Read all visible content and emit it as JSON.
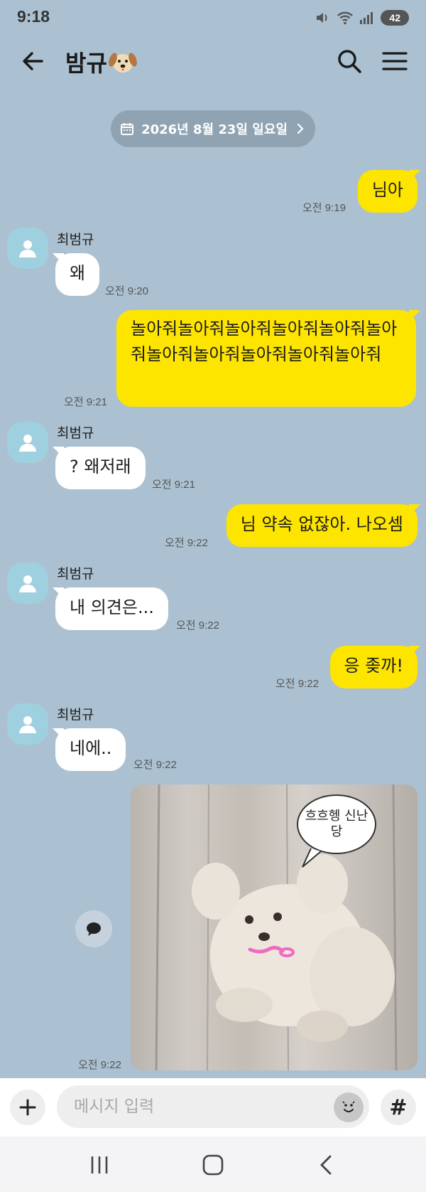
{
  "status_bar": {
    "time": "9:18",
    "battery": "42"
  },
  "header": {
    "title": "밤규"
  },
  "date_chip": {
    "label": "2026년 8월 23일 일요일"
  },
  "messages": [
    {
      "type": "out",
      "text": "님아",
      "time": "오전 9:19"
    },
    {
      "type": "in",
      "sender": "최범규",
      "text": "왜",
      "time": "오전 9:20"
    },
    {
      "type": "out",
      "text": "놀아줘놀아줘놀아줘놀아줘놀아줘놀아줘놀아줘놀아줘놀아줘놀아줘놀아줘",
      "time": "오전 9:21"
    },
    {
      "type": "in",
      "sender": "최범규",
      "text": "? 왜저래",
      "time": "오전 9:21"
    },
    {
      "type": "out",
      "text": "님 약속 없잖아. 나오셈",
      "time": "오전 9:22"
    },
    {
      "type": "in",
      "sender": "최범규",
      "text": "내 의견은...",
      "time": "오전 9:22"
    },
    {
      "type": "out",
      "text": "응 좆까!",
      "time": "오전 9:22"
    },
    {
      "type": "in",
      "sender": "최범규",
      "text": "네에..",
      "time": "오전 9:22"
    },
    {
      "type": "out-image",
      "caption": "흐흐헹 신난\n당",
      "time": "오전 9:22"
    }
  ],
  "input": {
    "placeholder": "메시지 입력"
  },
  "icons": {
    "back": "arrow-left-icon",
    "search": "search-icon",
    "menu": "hamburger-menu-icon",
    "calendar": "calendar-icon",
    "chevron": "chevron-right-icon",
    "plus": "plus-icon",
    "emoji": "emoji-icon",
    "hash": "#"
  },
  "colors": {
    "background": "#abc1d1",
    "outgoing_bubble": "#fee500",
    "incoming_bubble": "#ffffff",
    "date_chip": "#8fa3b3"
  }
}
